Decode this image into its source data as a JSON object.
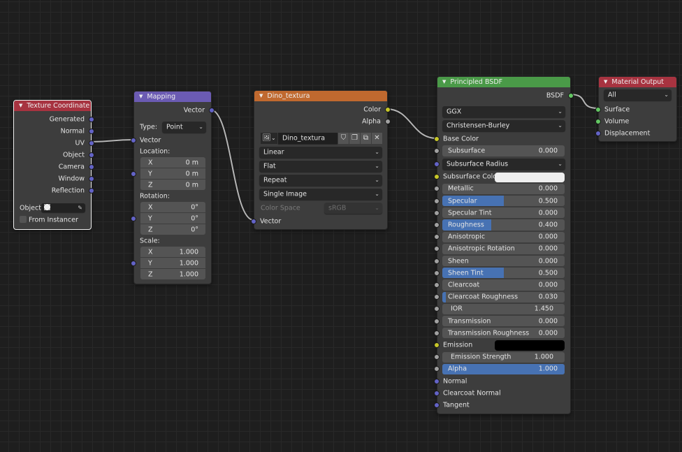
{
  "socket_colors": {
    "vector": "#6363c7",
    "color": "#c7c729",
    "float": "#a1a1a1",
    "shader": "#63c763"
  },
  "accent_fill": "#4772b3",
  "nodes": [
    {
      "id": "texture_coordinate",
      "title": "Texture Coordinate",
      "header_color": "#a73340",
      "selected": true,
      "rows": [
        {
          "type": "out",
          "label": "Generated",
          "socket": "vector"
        },
        {
          "type": "out",
          "label": "Normal",
          "socket": "vector"
        },
        {
          "type": "out",
          "label": "UV",
          "socket": "vector"
        },
        {
          "type": "out",
          "label": "Object",
          "socket": "vector"
        },
        {
          "type": "out",
          "label": "Camera",
          "socket": "vector"
        },
        {
          "type": "out",
          "label": "Window",
          "socket": "vector"
        },
        {
          "type": "out",
          "label": "Reflection",
          "socket": "vector"
        },
        {
          "type": "object",
          "label": "Object:",
          "value": ""
        },
        {
          "type": "checkbox",
          "label": "From Instancer",
          "checked": false
        }
      ]
    },
    {
      "id": "mapping",
      "title": "Mapping",
      "header_color": "#6b5bb3",
      "rows": [
        {
          "type": "out",
          "label": "Vector",
          "socket": "vector"
        },
        {
          "type": "dropdown",
          "label": "Type:",
          "value": "Point"
        },
        {
          "type": "in",
          "label": "Vector",
          "socket": "vector"
        },
        {
          "type": "heading",
          "label": "Location:"
        },
        {
          "type": "xyz",
          "socket": "vector",
          "items": [
            {
              "axis": "X",
              "value": "0 m"
            },
            {
              "axis": "Y",
              "value": "0 m"
            },
            {
              "axis": "Z",
              "value": "0 m"
            }
          ]
        },
        {
          "type": "heading",
          "label": "Rotation:"
        },
        {
          "type": "xyz",
          "socket": "vector",
          "items": [
            {
              "axis": "X",
              "value": "0°"
            },
            {
              "axis": "Y",
              "value": "0°"
            },
            {
              "axis": "Z",
              "value": "0°"
            }
          ]
        },
        {
          "type": "heading",
          "label": "Scale:"
        },
        {
          "type": "xyz",
          "socket": "vector",
          "items": [
            {
              "axis": "X",
              "value": "1.000"
            },
            {
              "axis": "Y",
              "value": "1.000"
            },
            {
              "axis": "Z",
              "value": "1.000"
            }
          ]
        }
      ]
    },
    {
      "id": "dino_textura",
      "title": "Dino_textura",
      "header_color": "#c0692f",
      "rows": [
        {
          "type": "out",
          "label": "Color",
          "socket": "color"
        },
        {
          "type": "out",
          "label": "Alpha",
          "socket": "float"
        },
        {
          "type": "image",
          "value": "Dino_textura"
        },
        {
          "type": "dropdown",
          "value": "Linear"
        },
        {
          "type": "dropdown",
          "value": "Flat"
        },
        {
          "type": "dropdown",
          "value": "Repeat"
        },
        {
          "type": "dropdown",
          "value": "Single Image"
        },
        {
          "type": "prop",
          "label": "Color Space",
          "value": "sRGB",
          "disabled": true
        },
        {
          "type": "in",
          "label": "Vector",
          "socket": "vector"
        }
      ]
    },
    {
      "id": "principled_bsdf",
      "title": "Principled BSDF",
      "header_color": "#4a9a48",
      "rows": [
        {
          "type": "out",
          "label": "BSDF",
          "socket": "shader"
        },
        {
          "type": "dropdown",
          "value": "GGX"
        },
        {
          "type": "dropdown",
          "value": "Christensen-Burley"
        },
        {
          "type": "in",
          "label": "Base Color",
          "socket": "color"
        },
        {
          "type": "field",
          "label": "Subsurface",
          "value": "0.000",
          "fill": 0,
          "socket": "float"
        },
        {
          "type": "dropdown",
          "value": "Subsurface Radius",
          "socket": "vector"
        },
        {
          "type": "color",
          "label": "Subsurface Colo",
          "color": "#efefef",
          "socket": "color"
        },
        {
          "type": "field",
          "label": "Metallic",
          "value": "0.000",
          "fill": 0,
          "socket": "float"
        },
        {
          "type": "field",
          "label": "Specular",
          "value": "0.500",
          "fill": 0.5,
          "socket": "float"
        },
        {
          "type": "field",
          "label": "Specular Tint",
          "value": "0.000",
          "fill": 0,
          "socket": "float"
        },
        {
          "type": "field",
          "label": "Roughness",
          "value": "0.400",
          "fill": 0.4,
          "socket": "float"
        },
        {
          "type": "field",
          "label": "Anisotropic",
          "value": "0.000",
          "fill": 0,
          "socket": "float"
        },
        {
          "type": "field",
          "label": "Anisotropic Rotation",
          "value": "0.000",
          "fill": 0,
          "socket": "float"
        },
        {
          "type": "field",
          "label": "Sheen",
          "value": "0.000",
          "fill": 0,
          "socket": "float"
        },
        {
          "type": "field",
          "label": "Sheen Tint",
          "value": "0.500",
          "fill": 0.5,
          "socket": "float"
        },
        {
          "type": "field",
          "label": "Clearcoat",
          "value": "0.000",
          "fill": 0,
          "socket": "float"
        },
        {
          "type": "field",
          "label": "Clearcoat Roughness",
          "value": "0.030",
          "fill": 0.03,
          "socket": "float"
        },
        {
          "type": "field",
          "label": "IOR",
          "value": "1.450",
          "fill": null,
          "socket": "float"
        },
        {
          "type": "field",
          "label": "Transmission",
          "value": "0.000",
          "fill": 0,
          "socket": "float"
        },
        {
          "type": "field",
          "label": "Transmission Roughness",
          "value": "0.000",
          "fill": 0,
          "socket": "float"
        },
        {
          "type": "color",
          "label": "Emission",
          "color": "#000000",
          "socket": "color"
        },
        {
          "type": "field",
          "label": "Emission Strength",
          "value": "1.000",
          "fill": null,
          "socket": "float"
        },
        {
          "type": "field",
          "label": "Alpha",
          "value": "1.000",
          "fill": 1,
          "socket": "float"
        },
        {
          "type": "in",
          "label": "Normal",
          "socket": "vector"
        },
        {
          "type": "in",
          "label": "Clearcoat Normal",
          "socket": "vector"
        },
        {
          "type": "in",
          "label": "Tangent",
          "socket": "vector"
        }
      ]
    },
    {
      "id": "material_output",
      "title": "Material Output",
      "header_color": "#a73340",
      "rows": [
        {
          "type": "dropdown",
          "value": "All"
        },
        {
          "type": "in",
          "label": "Surface",
          "socket": "shader"
        },
        {
          "type": "in",
          "label": "Volume",
          "socket": "shader"
        },
        {
          "type": "in",
          "label": "Displacement",
          "socket": "vector"
        }
      ]
    }
  ],
  "links": [
    {
      "from": "Texture Coordinate.UV",
      "to": "Mapping.Vector"
    },
    {
      "from": "Mapping.Vector",
      "to": "Dino_textura.Vector"
    },
    {
      "from": "Dino_textura.Color",
      "to": "Principled BSDF.Base Color"
    },
    {
      "from": "Principled BSDF.BSDF",
      "to": "Material Output.Surface"
    }
  ]
}
